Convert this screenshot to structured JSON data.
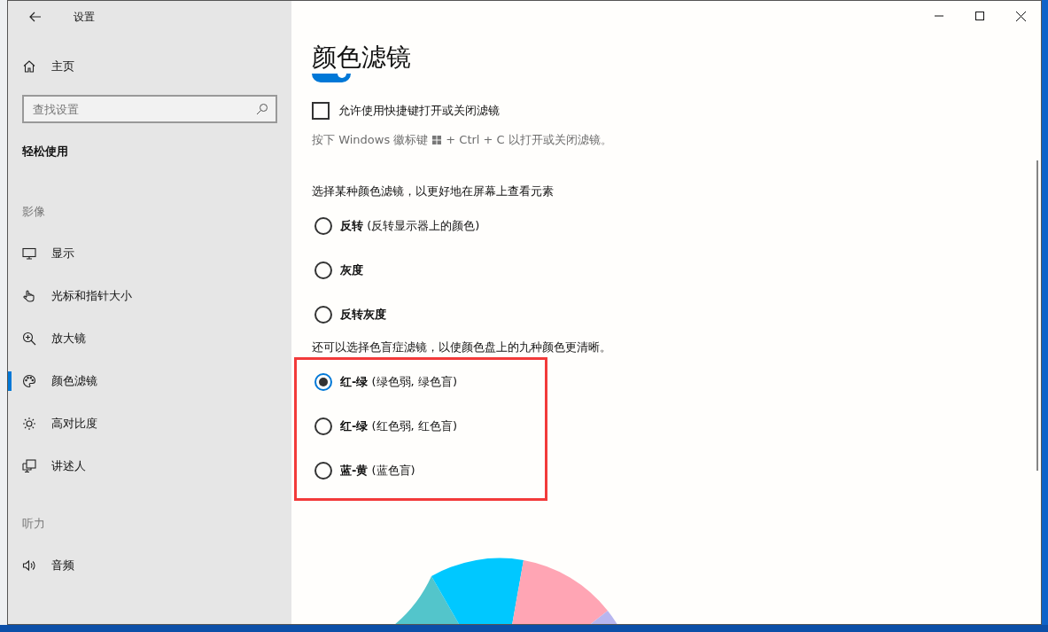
{
  "window": {
    "title": "设置"
  },
  "sidebar": {
    "home": {
      "label": "主页"
    },
    "search": {
      "placeholder": "查找设置"
    },
    "category": "轻松使用",
    "groups": [
      {
        "heading": "影像",
        "items": [
          {
            "label": "显示",
            "selected": false
          },
          {
            "label": "光标和指针大小",
            "selected": false
          },
          {
            "label": "放大镜",
            "selected": false
          },
          {
            "label": "颜色滤镜",
            "selected": true
          },
          {
            "label": "高对比度",
            "selected": false
          },
          {
            "label": "讲述人",
            "selected": false
          }
        ]
      },
      {
        "heading": "听力",
        "items": [
          {
            "label": "音频",
            "selected": false
          }
        ]
      }
    ]
  },
  "content": {
    "title": "颜色滤镜",
    "filter_toggle": {
      "on": true
    },
    "shortcut": {
      "label": "允许使用快捷键打开或关闭滤镜",
      "checked": false
    },
    "shortcut_hint": {
      "before": "按下 Windows 徽标键",
      "after": "+ Ctrl + C 以打开或关闭滤镜。"
    },
    "filters": {
      "heading": "选择某种颜色滤镜，以更好地在屏幕上查看元素",
      "highlighted": false,
      "options": [
        {
          "label": "**反转** (反转显示器上的颜色)",
          "selected": false
        },
        {
          "label": "**灰度**",
          "selected": false
        },
        {
          "label": "**反转灰度**",
          "selected": false
        }
      ]
    },
    "colorblind": {
      "heading": "还可以选择色盲症滤镜，以使颜色盘上的九种颜色更清晰。",
      "highlighted": true,
      "options": [
        {
          "label": "**红-绿** (绿色弱, 绿色盲)",
          "selected": true
        },
        {
          "label": "**红-绿** (红色弱, 红色盲)",
          "selected": false
        },
        {
          "label": "**蓝-黄** (蓝色盲)",
          "selected": false
        }
      ]
    }
  }
}
